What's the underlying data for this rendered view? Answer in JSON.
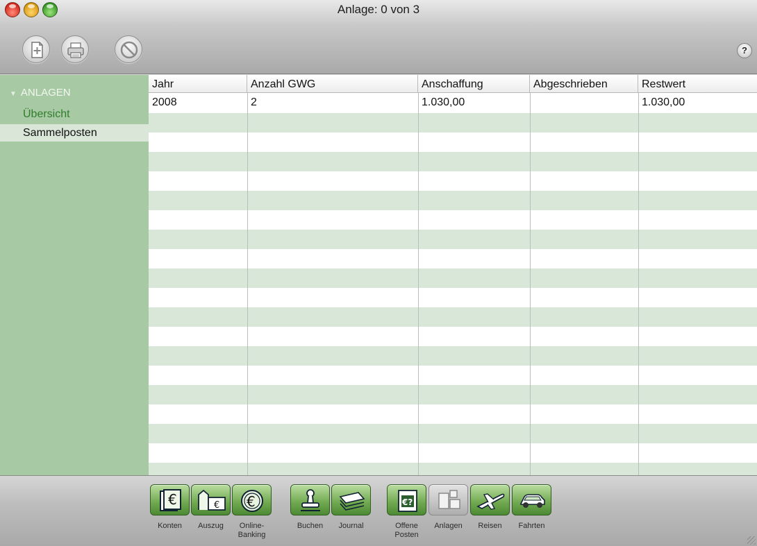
{
  "window": {
    "title": "Anlage: 0 von 3"
  },
  "toolbar": {
    "buttons": [
      {
        "name": "new-document",
        "icon": "new-document-icon"
      },
      {
        "name": "print",
        "icon": "printer-icon"
      },
      {
        "name": "delete",
        "icon": "prohibited-icon"
      }
    ],
    "help_label": "?"
  },
  "sidebar": {
    "group_label": "ANLAGEN",
    "group_triangle": "▼",
    "items": [
      {
        "label": "Übersicht",
        "state": "active"
      },
      {
        "label": "Sammelposten",
        "state": "selected"
      }
    ]
  },
  "table": {
    "columns": [
      "Jahr",
      "Anzahl GWG",
      "Anschaffung",
      "Abgeschrieben",
      "Restwert"
    ],
    "rows": [
      [
        "2008",
        "2",
        "1.030,00",
        "",
        "1.030,00"
      ]
    ]
  },
  "bottom_nav": {
    "items": [
      {
        "label": "Konten",
        "icon": "euro-notes-icon"
      },
      {
        "label": "Auszug",
        "icon": "bank-statement-icon"
      },
      {
        "label": "Online-\nBanking",
        "icon": "euro-coin-icon"
      },
      {
        "label": "Buchen",
        "icon": "stamp-icon"
      },
      {
        "label": "Journal",
        "icon": "journal-stack-icon"
      },
      {
        "label": "Offene\nPosten",
        "icon": "open-items-icon"
      },
      {
        "label": "Anlagen",
        "icon": "assets-icon",
        "state": "disabled"
      },
      {
        "label": "Reisen",
        "icon": "airplane-icon"
      },
      {
        "label": "Fahrten",
        "icon": "car-icon"
      }
    ]
  },
  "colors": {
    "sidebar_bg": "#a7caa5",
    "row_stripe": "#d9e7d8",
    "active_item": "#2f7d2a",
    "nav_green": "#6fa84f"
  }
}
